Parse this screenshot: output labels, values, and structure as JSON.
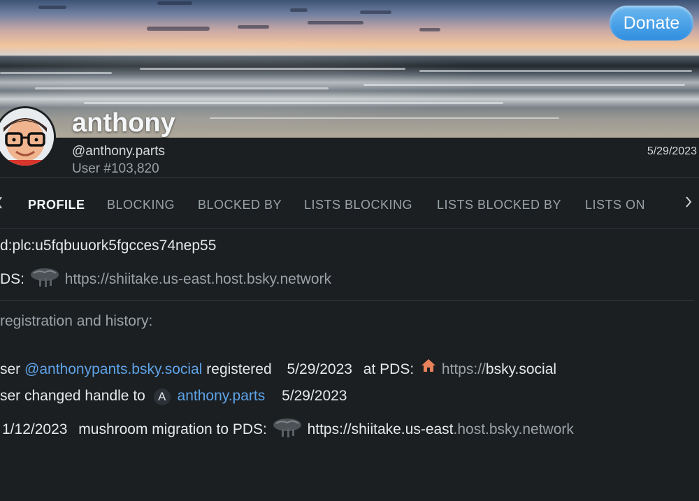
{
  "header": {
    "donate_label": "Donate",
    "name": "anthony",
    "handle": "@anthony.parts",
    "user_number": "User #103,820",
    "joined_date": "5/29/2023"
  },
  "tabs": [
    {
      "label": "PROFILE",
      "active": true
    },
    {
      "label": "BLOCKING",
      "active": false
    },
    {
      "label": "BLOCKED BY",
      "active": false
    },
    {
      "label": "LISTS BLOCKING",
      "active": false
    },
    {
      "label": "LISTS BLOCKED BY",
      "active": false
    },
    {
      "label": "LISTS ON",
      "active": false
    }
  ],
  "details": {
    "did": "d:plc:u5fqbuuork5fgcces74nep55",
    "pds_label": "DS:",
    "pds_url_main": "https://shiitake.us-east",
    "pds_url_rest": ".host.bsky.network",
    "history_title": "registration and history:"
  },
  "history": {
    "registered": {
      "prefix": "ser",
      "handle": "@anthonypants.bsky.social",
      "verb": "registered",
      "date": "5/29/2023",
      "at": "at PDS:",
      "pds_prefix": "https://",
      "pds_host": "bsky.social"
    },
    "handle_change": {
      "text": "ser changed handle to",
      "badge": "A",
      "new_handle": "anthony.parts",
      "date": "5/29/2023"
    },
    "migration": {
      "date": "1/12/2023",
      "text": "mushroom migration to PDS:",
      "pds_url_main": "https://shiitake.us-east",
      "pds_url_rest": ".host.bsky.network"
    }
  },
  "icons": {
    "pds_icon": "mushroom-icon",
    "home_icon": "home-icon",
    "chevron": "chevron-right-icon"
  },
  "colors": {
    "background": "#1b1f22",
    "link": "#5fa3e8",
    "home_icon": "#e8825a",
    "donate_button": "#2f8ee0"
  }
}
